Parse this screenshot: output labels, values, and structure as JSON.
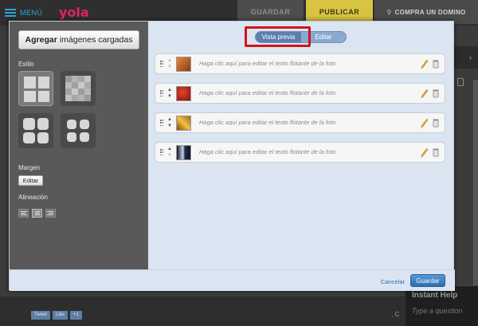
{
  "topbar": {
    "menu_label": "MENÚ",
    "logo": "yola",
    "save_label": "GUARDAR",
    "publish_label": "PUBLICAR",
    "domain_label": "COMPRA UN DOMINO",
    "publish_color": "#d8c440",
    "accent_color": "#2aa6d6"
  },
  "modal": {
    "add_images_bold": "Agregar",
    "add_images_rest": "imágenes cargadas",
    "style_label": "Estilo",
    "margin_label": "Margen",
    "margin_edit_label": "Editar",
    "alignment_label": "Alineación",
    "alignment_options": [
      "left",
      "center",
      "right"
    ],
    "alignment_selected": "center",
    "style_options": [
      "grid",
      "mosaic",
      "rounded-grid",
      "rounded-grid-spaced"
    ],
    "style_selected": "grid",
    "toggle": {
      "preview_label": "Vista previa",
      "edit_label": "Editar",
      "active": "preview"
    },
    "photos": [
      {
        "caption": "Haga clic aquí para editar el texto flotante de la foto",
        "thumb_color": "#c0662a"
      },
      {
        "caption": "Haga clic aquí para editar el texto flotante de la foto",
        "thumb_color": "#b81d16"
      },
      {
        "caption": "Haga clic aquí para editar el texto flotante de la foto",
        "thumb_color": "#d69a22"
      },
      {
        "caption": "Haga clic aquí para editar el texto flotante de la foto",
        "thumb_color": "#1e2d4a"
      }
    ],
    "cancel_label": "Cancelar",
    "save_label": "Guardar",
    "save_color": "#2c6db2"
  },
  "background": {
    "social": [
      "Tweet",
      "Like",
      "+1"
    ],
    "instant_help_title": "Instant Help",
    "instant_help_placeholder": "Type a question",
    "partial_text": ", C"
  }
}
